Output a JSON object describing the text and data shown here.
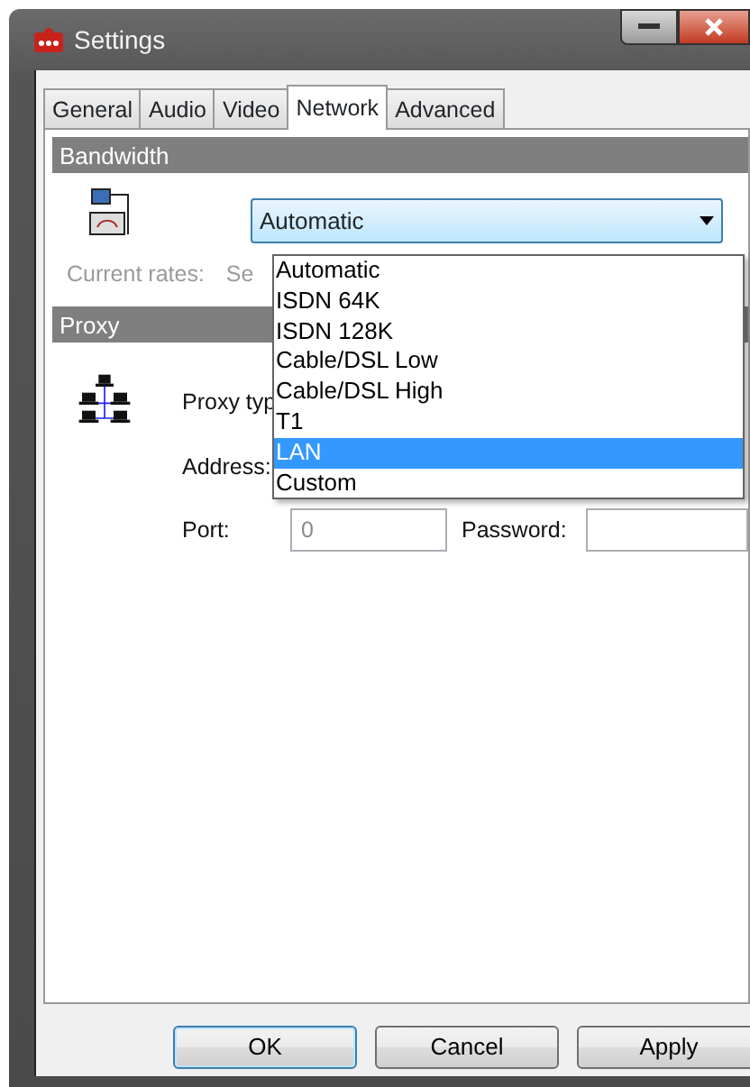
{
  "window": {
    "title": "Settings"
  },
  "tabs": [
    {
      "label": "General",
      "selected": false
    },
    {
      "label": "Audio",
      "selected": false
    },
    {
      "label": "Video",
      "selected": false
    },
    {
      "label": "Network",
      "selected": true
    },
    {
      "label": "Advanced",
      "selected": false
    }
  ],
  "bandwidth": {
    "heading": "Bandwidth",
    "select_value": "Automatic",
    "current_rates_label": "Current rates:",
    "current_rates_value": "Se",
    "options": [
      {
        "label": "Automatic",
        "selected": false
      },
      {
        "label": "ISDN 64K",
        "selected": false
      },
      {
        "label": "ISDN 128K",
        "selected": false
      },
      {
        "label": "Cable/DSL Low",
        "selected": false
      },
      {
        "label": "Cable/DSL High",
        "selected": false
      },
      {
        "label": "T1",
        "selected": false
      },
      {
        "label": "LAN",
        "selected": true
      },
      {
        "label": "Custom",
        "selected": false
      }
    ]
  },
  "proxy": {
    "heading": "Proxy",
    "type_label": "Proxy typ",
    "address_label": "Address:",
    "port_label": "Port:",
    "port_value": "0",
    "password_label": "Password:"
  },
  "buttons": [
    {
      "label": "OK",
      "default": true
    },
    {
      "label": "Cancel",
      "default": false
    },
    {
      "label": "Apply",
      "default": false
    }
  ]
}
